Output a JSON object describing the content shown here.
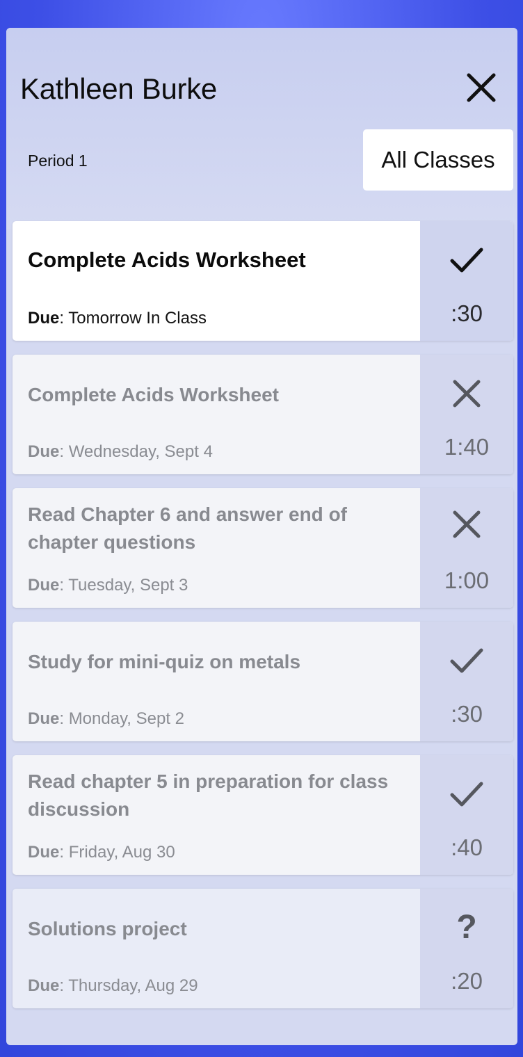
{
  "header": {
    "student_name": "Kathleen Burke",
    "period": "Period 1",
    "all_classes_label": "All Classes"
  },
  "due_label": "Due",
  "tasks": [
    {
      "title": "Complete Acids Worksheet",
      "due": "Tomorrow In Class",
      "status": "check-icon",
      "time": ":30",
      "active": true
    },
    {
      "title": "Complete Acids Worksheet",
      "due": "Wednesday, Sept 4",
      "status": "x-icon",
      "time": "1:40"
    },
    {
      "title": "Read Chapter 6 and answer end of chapter questions",
      "due": "Tuesday, Sept 3",
      "status": "x-icon",
      "time": "1:00"
    },
    {
      "title": "Study for mini-quiz on metals",
      "due": "Monday, Sept 2",
      "status": "check-icon",
      "time": ":30"
    },
    {
      "title": "Read chapter 5 in preparation for class discussion",
      "due": "Friday, Aug 30",
      "status": "check-icon",
      "time": ":40"
    },
    {
      "title": "Solutions project",
      "due": "Thursday, Aug 29",
      "status": "question-icon",
      "time": ":20"
    }
  ],
  "colors": {
    "background": "#4a5cf0",
    "sheet": "#d4d9f1",
    "status_side": "#d3d7ee"
  }
}
